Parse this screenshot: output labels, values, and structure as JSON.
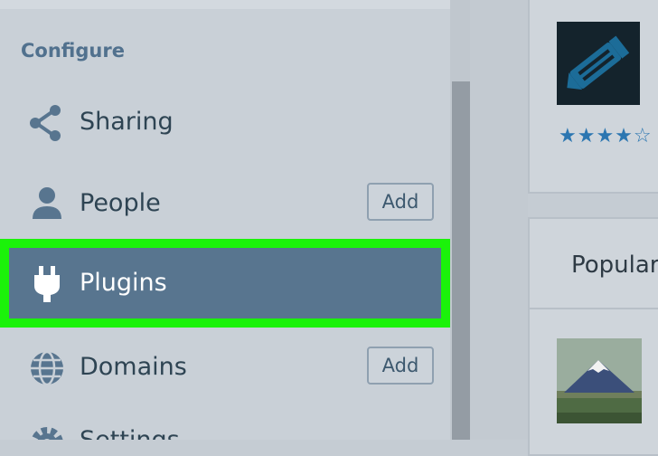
{
  "sidebar": {
    "section_title": "Configure",
    "items": [
      {
        "label": "Sharing",
        "icon": "share-icon"
      },
      {
        "label": "People",
        "icon": "person-icon",
        "action": "Add"
      },
      {
        "label": "Plugins",
        "icon": "plug-icon",
        "active": true
      },
      {
        "label": "Domains",
        "icon": "globe-icon",
        "action": "Add"
      },
      {
        "label": "Settings",
        "icon": "gear-icon"
      }
    ]
  },
  "right_panel": {
    "plugin_rating": "★★★★☆",
    "popular_heading": "Popular"
  },
  "colors": {
    "accent_active": "#58758f",
    "highlight": "#1bf20a",
    "text": "#2e4453",
    "section_title": "#51718e",
    "star": "#2b76b1"
  }
}
